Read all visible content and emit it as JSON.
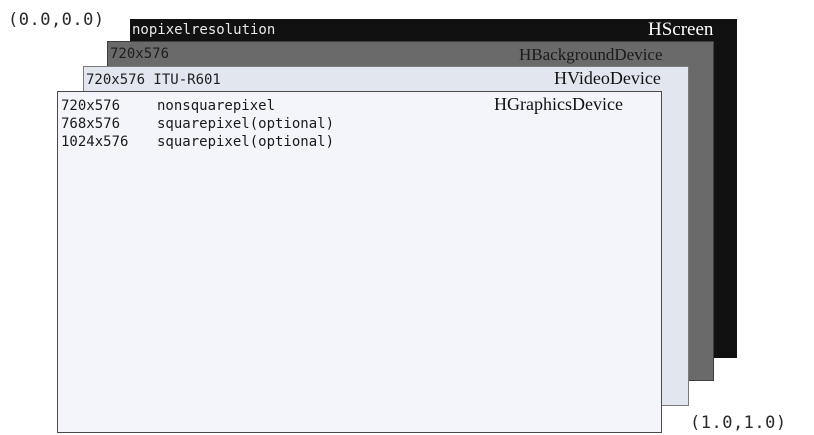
{
  "coordinates": {
    "origin": "(0.0,0.0)",
    "end": "(1.0,1.0)"
  },
  "layers": {
    "screen": {
      "device": "HScreen",
      "resolution": "nopixelresolution"
    },
    "background": {
      "device": "HBackgroundDevice",
      "resolution": "720x576"
    },
    "video": {
      "device": "HVideoDevice",
      "resolution": "720x576  ITU-R601"
    },
    "graphics": {
      "device": "HGraphicsDevice",
      "modes": [
        {
          "resolution": "720x576",
          "description": "nonsquarepixel"
        },
        {
          "resolution": "768x576",
          "description": "squarepixel(optional)"
        },
        {
          "resolution": "1024x576",
          "description": "squarepixel(optional)"
        }
      ]
    }
  },
  "colors": {
    "screen": "#111111",
    "background": "#6a6a6a",
    "video": "#e1e6ef",
    "graphics": "#f3f5fb"
  }
}
